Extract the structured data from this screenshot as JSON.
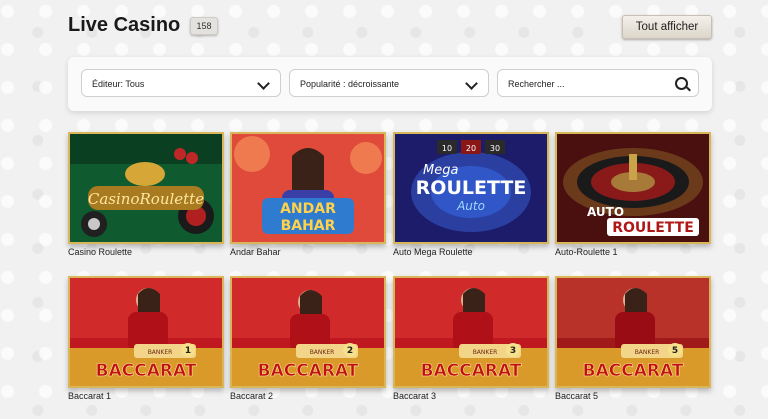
{
  "header": {
    "title": "Live Casino",
    "count": "158",
    "show_all_label": "Tout afficher"
  },
  "filters": {
    "editor_label": "Éditeur: Tous",
    "sort_label": "Popularité : décroissante",
    "search_placeholder": "Rechercher ..."
  },
  "games": [
    {
      "name": "Casino Roulette",
      "art": [
        "CasinoRoulette"
      ]
    },
    {
      "name": "Andar Bahar",
      "art": [
        "ANDAR",
        "BAHAR"
      ]
    },
    {
      "name": "Auto Mega Roulette",
      "art": [
        "Mega",
        "ROULETTE",
        "Auto",
        "10",
        "20",
        "30"
      ]
    },
    {
      "name": "Auto-Roulette 1",
      "art": [
        "AUTO",
        "ROULETTE"
      ]
    },
    {
      "name": "Baccarat 1",
      "art": [
        "BACCARAT",
        "1",
        "BANKER"
      ]
    },
    {
      "name": "Baccarat 2",
      "art": [
        "BACCARAT",
        "2",
        "BANKER"
      ]
    },
    {
      "name": "Baccarat 3",
      "art": [
        "BACCARAT",
        "3",
        "BANKER"
      ]
    },
    {
      "name": "Baccarat 5",
      "art": [
        "BACCARAT",
        "5",
        "BANKER"
      ]
    }
  ]
}
